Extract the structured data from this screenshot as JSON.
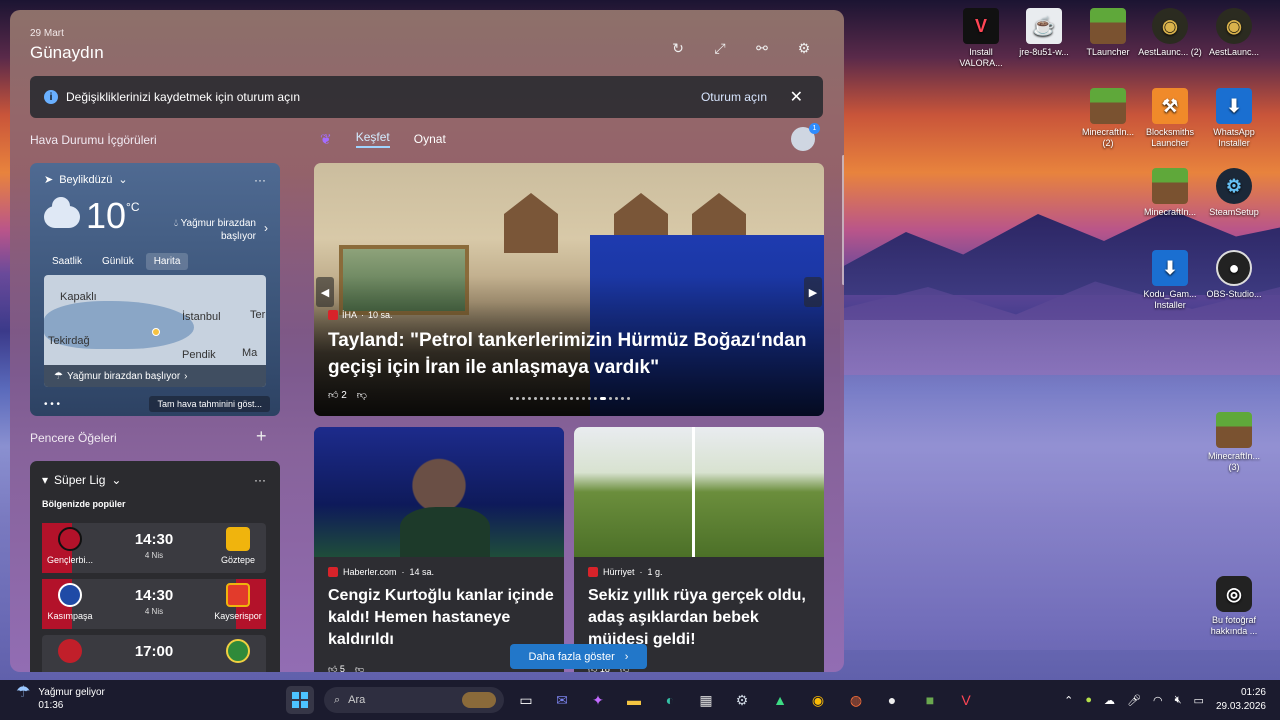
{
  "desktop": {
    "icons": [
      {
        "label": "Install VALORA...",
        "icon": "valorant-icon"
      },
      {
        "label": "jre-8u51-w...",
        "icon": "java-icon"
      },
      {
        "label": "TLauncher",
        "icon": "minecraft-icon"
      },
      {
        "label": "AestLaunc... (2)",
        "icon": "owl-icon"
      },
      {
        "label": "AestLaunc...",
        "icon": "owl-icon"
      },
      {
        "label": "MinecraftIn... (2)",
        "icon": "minecraft-icon"
      },
      {
        "label": "Blocksmiths Launcher",
        "icon": "hammer-icon"
      },
      {
        "label": "WhatsApp Installer",
        "icon": "download-icon"
      },
      {
        "label": "MinecraftIn...",
        "icon": "minecraft-icon"
      },
      {
        "label": "SteamSetup",
        "icon": "steam-icon"
      },
      {
        "label": "Kodu_Gam... Installer",
        "icon": "download-icon"
      },
      {
        "label": "OBS-Studio...",
        "icon": "obs-icon"
      },
      {
        "label": "MinecraftIn... (3)",
        "icon": "minecraft-icon"
      },
      {
        "label": "Bu fotoğraf hakkında ...",
        "icon": "camera-icon"
      }
    ]
  },
  "widgets": {
    "date": "29 Mart",
    "greeting": "Günaydın",
    "toolbar_icons": [
      "refresh-icon",
      "expand-icon",
      "share-icon",
      "settings-icon"
    ],
    "banner": {
      "text": "Değişikliklerinizi kaydetmek için oturum açın",
      "action": "Oturum açın"
    },
    "weather_section": "Hava Durumu İçgörüleri",
    "weather": {
      "location": "Beylikdüzü",
      "temp": "10",
      "unit": "°C",
      "desc_line1": "Yağmur birazdan",
      "desc_line2": "başlıyor",
      "tabs": [
        "Saatlik",
        "Günlük",
        "Harita"
      ],
      "active_tab": "Harita",
      "map_labels": [
        "Kapaklı",
        "İstanbul",
        "Tekirdağ",
        "Pendik",
        "Ter",
        "Ma"
      ],
      "map_note": "Yağmur birazdan başlıyor",
      "forecast_button": "Tam hava tahminini göst..."
    },
    "pencere_section": "Pencere Öğeleri",
    "league": {
      "name": "Süper Lig",
      "subtitle": "Bölgenizde popüler",
      "matches": [
        {
          "home": "Gençlerbi...",
          "away": "Göztepe",
          "time": "14:30",
          "date": "4 Nis",
          "home_color": "#b3122a",
          "away_color": "#f0b40d"
        },
        {
          "home": "Kasımpaşa",
          "away": "Kayserispor",
          "time": "14:30",
          "date": "4 Nis",
          "home_color": "#1f4aa6",
          "away_color": "#e23b2b"
        },
        {
          "home": "",
          "away": "",
          "time": "17:00",
          "date": "",
          "home_color": "#c11f2a",
          "away_color": "#2f8a3a"
        }
      ]
    },
    "feed": {
      "tabs": [
        "Keşfet",
        "Oynat"
      ],
      "active_tab": "Keşfet",
      "avatar_badge": "1",
      "hero": {
        "source": "İHA",
        "age": "10 sa.",
        "title": "Tayland: \"Petrol tankerlerimizin Hürmüz Boğazı‘ndan geçişi için İran ile anlaşmaya vardık\"",
        "likes": "2"
      },
      "cards": [
        {
          "source": "Haberler.com",
          "age": "14 sa.",
          "title": "Cengiz Kurtoğlu kanlar içinde kaldı! Hemen hastaneye kaldırıldı",
          "likes": "5"
        },
        {
          "source": "Hürriyet",
          "age": "1 g.",
          "title": "Sekiz yıllık rüya gerçek oldu, adaş aşıklardan bebek müjdesi geldi!",
          "likes": "18"
        }
      ],
      "more_button": "Daha fazla göster"
    }
  },
  "taskbar": {
    "weather_title": "Yağmur geliyor",
    "weather_time": "01:36",
    "search_placeholder": "Ara",
    "apps": [
      "task-view-icon",
      "teams-icon",
      "copilot-icon",
      "file-explorer-icon",
      "edge-icon",
      "store-icon",
      "steam-icon",
      "android-icon",
      "chrome-icon",
      "firefox-icon",
      "obs-icon",
      "minecraft-icon",
      "valorant-icon"
    ],
    "time": "01:26",
    "date": "29.03.2026"
  }
}
